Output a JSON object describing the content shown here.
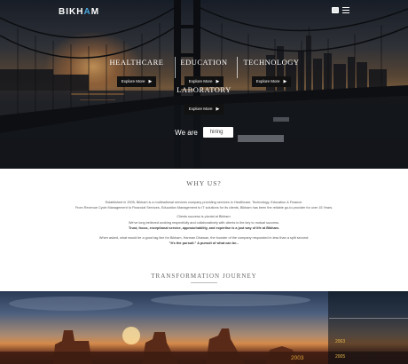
{
  "header": {
    "logo_text": "BIKH",
    "logo_accent": "A",
    "logo_text_end": "M",
    "icons": [
      "square-icon",
      "menu-icon"
    ]
  },
  "hero": {
    "divisions": [
      {
        "title": "HEALTHCARE",
        "cta": "Explore More"
      },
      {
        "title": "EDUCATION",
        "cta": "Explore More"
      },
      {
        "title": "TECHNOLOGY",
        "cta": "Explore More"
      },
      {
        "title": "LABORATORY",
        "cta": "Explore More"
      }
    ],
    "we_are": "We are",
    "rotating_word": "hiring"
  },
  "why": {
    "heading": "WHY US?",
    "paragraph_1": "Established in 2005, Bikham is a multinational services company providing services in Healthcare, Technology, Education & Finance.",
    "paragraph_2": "From Revenue Cycle Management to Financial Services, Education Management to IT solutions for its clients, Bikham has been the reliable go-to provider for over 15 Years.",
    "paragraph_3": "Clients success is pivotal at Bikham.",
    "paragraph_4": "We've long believed working respectfully and collaboratively with clients is the key to mutual success.",
    "paragraph_5": "Trust, focus, exceptional service, approachability, and expertise is a just way of life at Bikham.",
    "paragraph_6": "When asked, what would be a good tag line for Bikham, Harman Dhawan, the founder of the company responded in less than a split second:",
    "paragraph_7": "\"It's the pursuit.\" A pursuit of what can be..."
  },
  "transformation": {
    "heading": "TRANSFORMATION JOURNEY",
    "years": [
      "2003",
      "2003",
      "2005"
    ]
  },
  "colors": {
    "logo_accent": "#4aa8e0",
    "year_gold": "#e3a43a",
    "explore_bg": "#111111"
  }
}
